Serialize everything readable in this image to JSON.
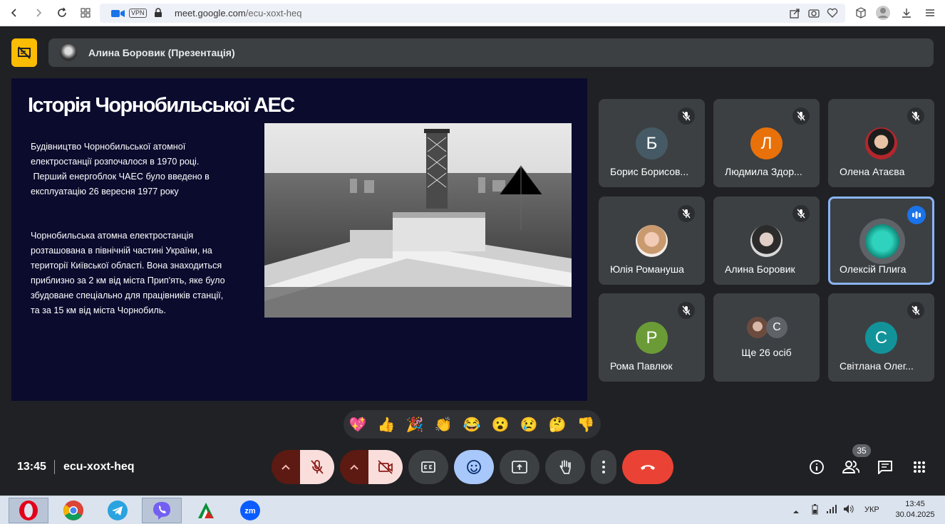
{
  "browser": {
    "url_domain": "meet.google.com",
    "url_path": "/ecu-xoxt-heq",
    "vpn_label": "VPN"
  },
  "header": {
    "presenter_label": "Алина Боровик (Презентація)"
  },
  "slide": {
    "title": "Історія Чорнобильської АЕС",
    "para1_line1": "Будівництво Чорнобильської атомної",
    "para1_line2": "електростанції розпочалося в 1970 році.",
    "para1_line3": " Перший енергоблок ЧАЕС було введено в",
    "para1_line4": "експлуатацію 26 вересня 1977 року",
    "para2_line1": "Чорнобильська атомна електростанція",
    "para2_line2": "розташована в північній частині України, на",
    "para2_line3": "території Київської області. Вона знаходиться",
    "para2_line4": "приблизно за 2 км від міста Прип'ять, яке було",
    "para2_line5": "збудоване спеціально для працівників станції,",
    "para2_line6": "та за 15 км від міста Чорнобиль."
  },
  "participants": [
    {
      "name": "Борис Борисов...",
      "initial": "Б",
      "color": "#455a64",
      "muted": true
    },
    {
      "name": "Людмила Здор...",
      "initial": "Л",
      "color": "#e8710a",
      "muted": true
    },
    {
      "name": "Олена Атаєва",
      "initial": "",
      "color": "#ffffff",
      "muted": true
    },
    {
      "name": "Юлія Романуша",
      "initial": "",
      "color": "#f1d9cf",
      "muted": true
    },
    {
      "name": "Алина Боровик",
      "initial": "",
      "color": "#e0e0e0",
      "muted": true
    },
    {
      "name": "Олексій Плига",
      "initial": "",
      "color": "#1fae9b",
      "muted": false,
      "speaking": true
    },
    {
      "name": "Рома Павлюк",
      "initial": "Р",
      "color": "#6b9b37",
      "muted": true
    },
    {
      "name": "Ще 26 осіб",
      "initial": "С",
      "color": "#5f6368"
    },
    {
      "name": "Світлана Олег...",
      "initial": "С",
      "color": "#12939a",
      "muted": true
    }
  ],
  "reactions": [
    "💖",
    "👍",
    "🎉",
    "👏",
    "😂",
    "😮",
    "😢",
    "🤔",
    "👎"
  ],
  "bottom": {
    "time": "13:45",
    "meeting_code": "ecu-xoxt-heq",
    "participant_count": "35"
  },
  "colors": {
    "end_call": "#ea4335",
    "reactions_active": "#a8c7fa",
    "mic_off_bg": "#f9dedc",
    "presenting_badge": "#fbbc04"
  },
  "taskbar": {
    "lang": "УКР",
    "time": "13:45",
    "date": "30.04.2025"
  }
}
